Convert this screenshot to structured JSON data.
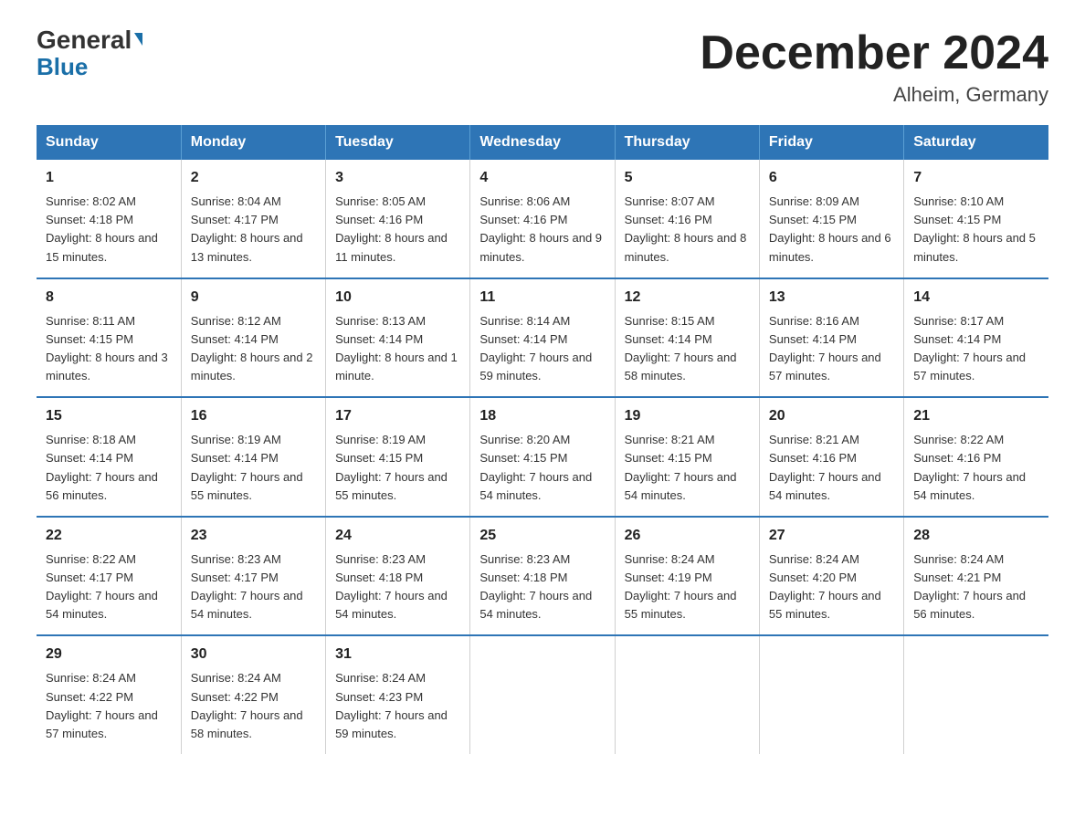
{
  "header": {
    "logo_general": "General",
    "logo_blue": "Blue",
    "month_title": "December 2024",
    "location": "Alheim, Germany"
  },
  "weekdays": [
    "Sunday",
    "Monday",
    "Tuesday",
    "Wednesday",
    "Thursday",
    "Friday",
    "Saturday"
  ],
  "weeks": [
    [
      {
        "day": "1",
        "sunrise": "8:02 AM",
        "sunset": "4:18 PM",
        "daylight": "8 hours and 15 minutes."
      },
      {
        "day": "2",
        "sunrise": "8:04 AM",
        "sunset": "4:17 PM",
        "daylight": "8 hours and 13 minutes."
      },
      {
        "day": "3",
        "sunrise": "8:05 AM",
        "sunset": "4:16 PM",
        "daylight": "8 hours and 11 minutes."
      },
      {
        "day": "4",
        "sunrise": "8:06 AM",
        "sunset": "4:16 PM",
        "daylight": "8 hours and 9 minutes."
      },
      {
        "day": "5",
        "sunrise": "8:07 AM",
        "sunset": "4:16 PM",
        "daylight": "8 hours and 8 minutes."
      },
      {
        "day": "6",
        "sunrise": "8:09 AM",
        "sunset": "4:15 PM",
        "daylight": "8 hours and 6 minutes."
      },
      {
        "day": "7",
        "sunrise": "8:10 AM",
        "sunset": "4:15 PM",
        "daylight": "8 hours and 5 minutes."
      }
    ],
    [
      {
        "day": "8",
        "sunrise": "8:11 AM",
        "sunset": "4:15 PM",
        "daylight": "8 hours and 3 minutes."
      },
      {
        "day": "9",
        "sunrise": "8:12 AM",
        "sunset": "4:14 PM",
        "daylight": "8 hours and 2 minutes."
      },
      {
        "day": "10",
        "sunrise": "8:13 AM",
        "sunset": "4:14 PM",
        "daylight": "8 hours and 1 minute."
      },
      {
        "day": "11",
        "sunrise": "8:14 AM",
        "sunset": "4:14 PM",
        "daylight": "7 hours and 59 minutes."
      },
      {
        "day": "12",
        "sunrise": "8:15 AM",
        "sunset": "4:14 PM",
        "daylight": "7 hours and 58 minutes."
      },
      {
        "day": "13",
        "sunrise": "8:16 AM",
        "sunset": "4:14 PM",
        "daylight": "7 hours and 57 minutes."
      },
      {
        "day": "14",
        "sunrise": "8:17 AM",
        "sunset": "4:14 PM",
        "daylight": "7 hours and 57 minutes."
      }
    ],
    [
      {
        "day": "15",
        "sunrise": "8:18 AM",
        "sunset": "4:14 PM",
        "daylight": "7 hours and 56 minutes."
      },
      {
        "day": "16",
        "sunrise": "8:19 AM",
        "sunset": "4:14 PM",
        "daylight": "7 hours and 55 minutes."
      },
      {
        "day": "17",
        "sunrise": "8:19 AM",
        "sunset": "4:15 PM",
        "daylight": "7 hours and 55 minutes."
      },
      {
        "day": "18",
        "sunrise": "8:20 AM",
        "sunset": "4:15 PM",
        "daylight": "7 hours and 54 minutes."
      },
      {
        "day": "19",
        "sunrise": "8:21 AM",
        "sunset": "4:15 PM",
        "daylight": "7 hours and 54 minutes."
      },
      {
        "day": "20",
        "sunrise": "8:21 AM",
        "sunset": "4:16 PM",
        "daylight": "7 hours and 54 minutes."
      },
      {
        "day": "21",
        "sunrise": "8:22 AM",
        "sunset": "4:16 PM",
        "daylight": "7 hours and 54 minutes."
      }
    ],
    [
      {
        "day": "22",
        "sunrise": "8:22 AM",
        "sunset": "4:17 PM",
        "daylight": "7 hours and 54 minutes."
      },
      {
        "day": "23",
        "sunrise": "8:23 AM",
        "sunset": "4:17 PM",
        "daylight": "7 hours and 54 minutes."
      },
      {
        "day": "24",
        "sunrise": "8:23 AM",
        "sunset": "4:18 PM",
        "daylight": "7 hours and 54 minutes."
      },
      {
        "day": "25",
        "sunrise": "8:23 AM",
        "sunset": "4:18 PM",
        "daylight": "7 hours and 54 minutes."
      },
      {
        "day": "26",
        "sunrise": "8:24 AM",
        "sunset": "4:19 PM",
        "daylight": "7 hours and 55 minutes."
      },
      {
        "day": "27",
        "sunrise": "8:24 AM",
        "sunset": "4:20 PM",
        "daylight": "7 hours and 55 minutes."
      },
      {
        "day": "28",
        "sunrise": "8:24 AM",
        "sunset": "4:21 PM",
        "daylight": "7 hours and 56 minutes."
      }
    ],
    [
      {
        "day": "29",
        "sunrise": "8:24 AM",
        "sunset": "4:22 PM",
        "daylight": "7 hours and 57 minutes."
      },
      {
        "day": "30",
        "sunrise": "8:24 AM",
        "sunset": "4:22 PM",
        "daylight": "7 hours and 58 minutes."
      },
      {
        "day": "31",
        "sunrise": "8:24 AM",
        "sunset": "4:23 PM",
        "daylight": "7 hours and 59 minutes."
      },
      null,
      null,
      null,
      null
    ]
  ],
  "labels": {
    "sunrise": "Sunrise:",
    "sunset": "Sunset:",
    "daylight": "Daylight:"
  }
}
